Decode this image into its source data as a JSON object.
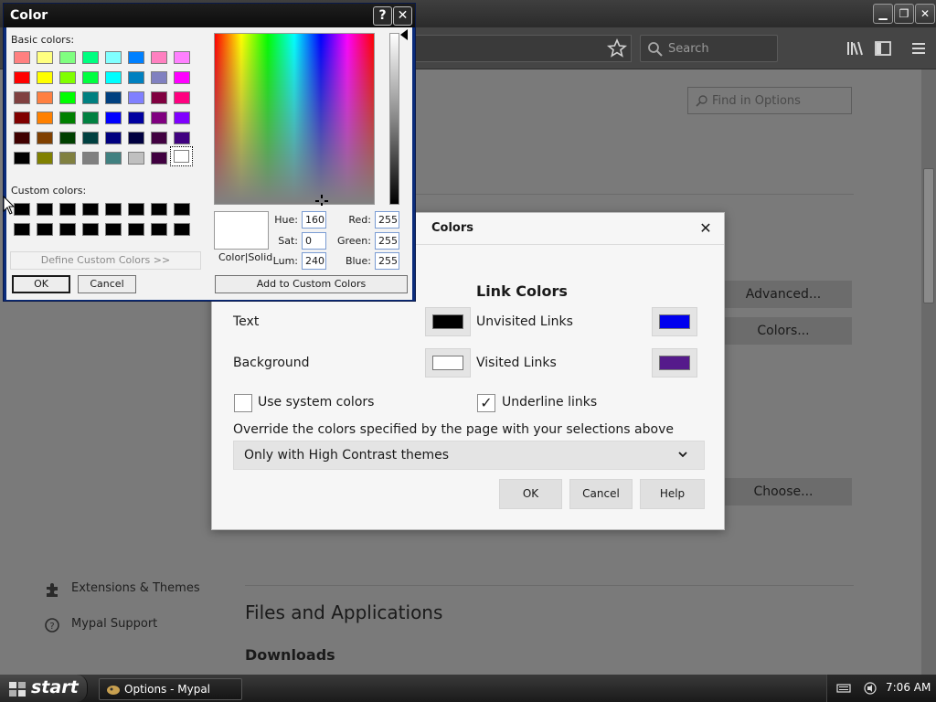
{
  "browser": {
    "search_placeholder": "Search",
    "find_placeholder": "Find in Options",
    "buttons": {
      "advanced": "Advanced...",
      "colors": "Colors...",
      "choose": "Choose..."
    },
    "sidebar": [
      {
        "label": "Extensions & Themes",
        "icon": "puzzle-icon"
      },
      {
        "label": "Mypal Support",
        "icon": "help-icon"
      }
    ],
    "section_files": "Files and Applications",
    "section_downloads": "Downloads"
  },
  "colors_dialog": {
    "title": "Colors",
    "link_colors_heading": "Link Colors",
    "text_label": "Text",
    "background_label": "Background",
    "unvisited_label": "Unvisited Links",
    "visited_label": "Visited Links",
    "use_system_colors_label": "Use system colors",
    "use_system_colors_checked": false,
    "underline_links_label": "Underline links",
    "underline_links_checked": true,
    "checkmark": "✓",
    "override_label": "Override the colors specified by the page with your selections above",
    "override_value": "Only with High Contrast themes",
    "ok": "OK",
    "cancel": "Cancel",
    "help": "Help",
    "swatch_colors": {
      "text": "#000000",
      "background": "#ffffff",
      "unvisited": "#0000ee",
      "visited": "#551a8b"
    }
  },
  "color_picker": {
    "title": "Color",
    "help_glyph": "?",
    "close_glyph": "✕",
    "basic_colors_label": "Basic colors:",
    "custom_colors_label": "Custom colors:",
    "define_custom_colors": "Define Custom Colors >>",
    "ok": "OK",
    "cancel": "Cancel",
    "add_to_custom": "Add to Custom Colors",
    "color_solid_label": "Color|Solid",
    "fields": {
      "hue_label": "Hue:",
      "hue": "160",
      "sat_label": "Sat:",
      "sat": "0",
      "lum_label": "Lum:",
      "lum": "240",
      "red_label": "Red:",
      "red": "255",
      "green_label": "Green:",
      "green": "255",
      "blue_label": "Blue:",
      "blue": "255"
    },
    "basic_colors": [
      [
        "#ff8080",
        "#ffff80",
        "#80ff80",
        "#00ff80",
        "#80ffff",
        "#0080ff",
        "#ff80c0",
        "#ff80ff"
      ],
      [
        "#ff0000",
        "#ffff00",
        "#80ff00",
        "#00ff40",
        "#00ffff",
        "#0080c0",
        "#8080c0",
        "#ff00ff"
      ],
      [
        "#804040",
        "#ff8040",
        "#00ff00",
        "#008080",
        "#004080",
        "#8080ff",
        "#800040",
        "#ff0080"
      ],
      [
        "#800000",
        "#ff8000",
        "#008000",
        "#008040",
        "#0000ff",
        "#0000a0",
        "#800080",
        "#8000ff"
      ],
      [
        "#400000",
        "#804000",
        "#004000",
        "#004040",
        "#000080",
        "#000040",
        "#400040",
        "#400080"
      ],
      [
        "#000000",
        "#808000",
        "#808040",
        "#808080",
        "#408080",
        "#c0c0c0",
        "#400040"
      ]
    ],
    "selected_basic_color": "#ffffff",
    "custom_colors": "#000000"
  },
  "taskbar": {
    "start": "start",
    "task_label": "Options - Mypal",
    "clock": "7:06 AM"
  }
}
